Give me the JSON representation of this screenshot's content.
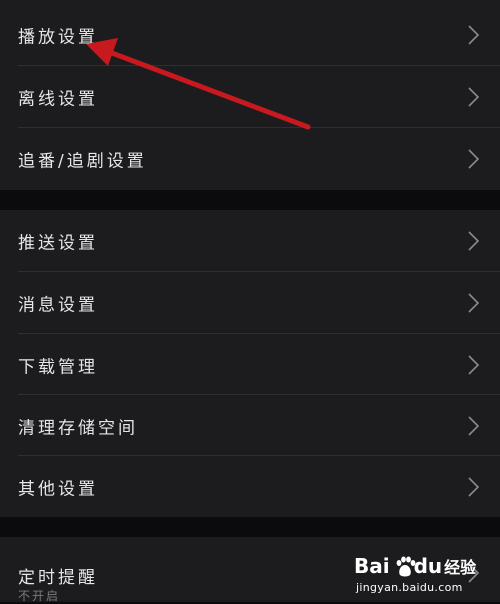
{
  "groups": [
    {
      "items": [
        {
          "label": "播放设置"
        },
        {
          "label": "离线设置"
        },
        {
          "label": "追番/追剧设置"
        }
      ]
    },
    {
      "items": [
        {
          "label": "推送设置"
        },
        {
          "label": "消息设置"
        },
        {
          "label": "下载管理"
        },
        {
          "label": "清理存储空间"
        },
        {
          "label": "其他设置"
        }
      ]
    },
    {
      "items": [
        {
          "label": "定时提醒",
          "sub": "不开启"
        }
      ]
    }
  ],
  "watermark": {
    "brand_bai": "Bai",
    "brand_du": "du",
    "brand_jy": "经验",
    "url": "jingyan.baidu.com"
  },
  "annotation_color": "#c8191e"
}
